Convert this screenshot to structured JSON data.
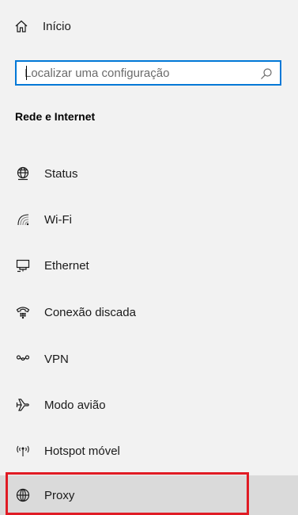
{
  "home": {
    "label": "Início",
    "icon": "home-icon"
  },
  "search": {
    "placeholder": "Localizar uma configuração",
    "value": "",
    "icon": "search-icon"
  },
  "section": {
    "title": "Rede e Internet"
  },
  "nav": {
    "items": [
      {
        "label": "Status",
        "icon": "globe-status-icon",
        "selected": false
      },
      {
        "label": "Wi-Fi",
        "icon": "wifi-icon",
        "selected": false
      },
      {
        "label": "Ethernet",
        "icon": "ethernet-icon",
        "selected": false
      },
      {
        "label": "Conexão discada",
        "icon": "dialup-phone-icon",
        "selected": false
      },
      {
        "label": "VPN",
        "icon": "vpn-icon",
        "selected": false
      },
      {
        "label": "Modo avião",
        "icon": "airplane-icon",
        "selected": false
      },
      {
        "label": "Hotspot móvel",
        "icon": "hotspot-icon",
        "selected": false
      },
      {
        "label": "Proxy",
        "icon": "globe-icon",
        "selected": true
      }
    ]
  },
  "colors": {
    "background": "#f2f2f2",
    "selected_row": "#dadada",
    "search_border": "#0078d7",
    "highlight_border": "#e01b24"
  }
}
